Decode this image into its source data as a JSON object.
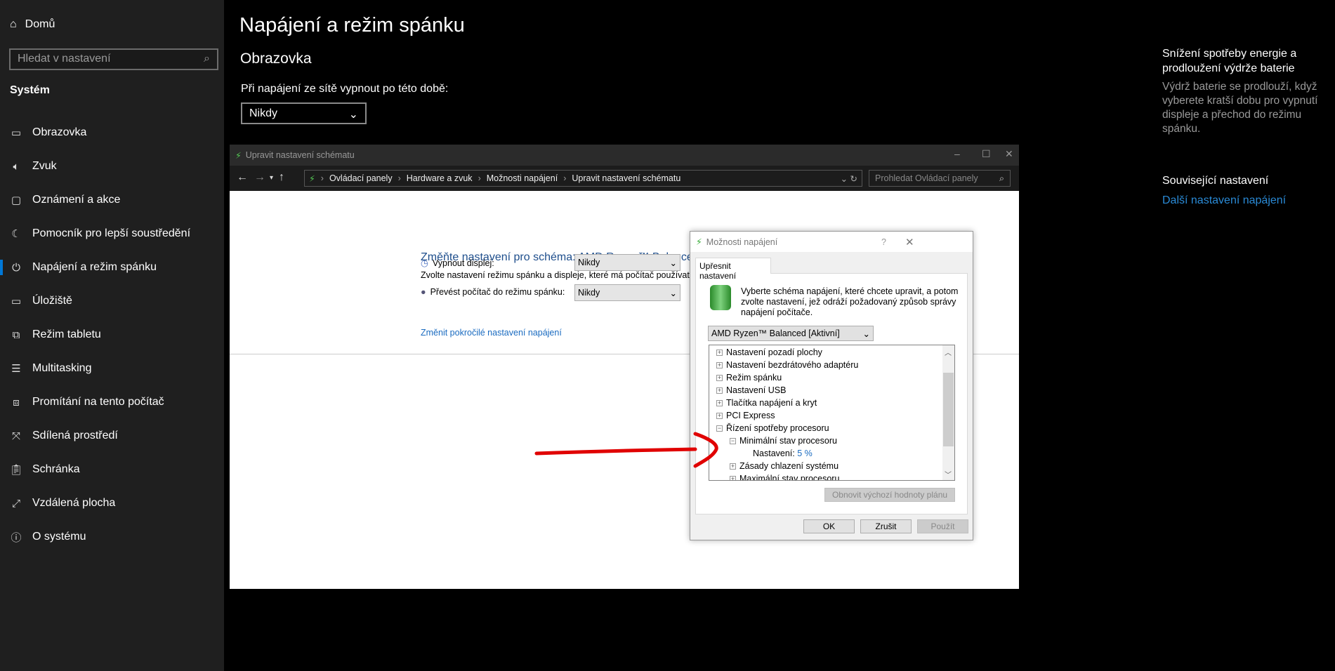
{
  "sidebar": {
    "home": "Domů",
    "search_placeholder": "Hledat v nastavení",
    "section": "Systém",
    "items": [
      {
        "label": "Obrazovka",
        "icon": "monitor-icon"
      },
      {
        "label": "Zvuk",
        "icon": "speaker-icon"
      },
      {
        "label": "Oznámení a akce",
        "icon": "notification-icon"
      },
      {
        "label": "Pomocník pro lepší soustředění",
        "icon": "moon-icon"
      },
      {
        "label": "Napájení a režim spánku",
        "icon": "power-icon"
      },
      {
        "label": "Úložiště",
        "icon": "storage-icon"
      },
      {
        "label": "Režim tabletu",
        "icon": "tablet-icon"
      },
      {
        "label": "Multitasking",
        "icon": "multitasking-icon"
      },
      {
        "label": "Promítání na tento počítač",
        "icon": "projecting-icon"
      },
      {
        "label": "Sdílená prostředí",
        "icon": "shared-icon"
      },
      {
        "label": "Schránka",
        "icon": "clipboard-icon"
      },
      {
        "label": "Vzdálená plocha",
        "icon": "remote-icon"
      },
      {
        "label": "O systému",
        "icon": "info-icon"
      }
    ]
  },
  "main": {
    "title": "Napájení a režim spánku",
    "section": "Obrazovka",
    "label": "Při napájení ze sítě vypnout po této době:",
    "dropdown": "Nikdy"
  },
  "right": {
    "heading": "Snížení spotřeby energie a prodloužení výdrže baterie",
    "text": "Výdrž baterie se prodlouží, když vyberete kratší dobu pro vypnutí displeje a přechod do režimu spánku.",
    "related": "Související nastavení",
    "link": "Další nastavení napájení"
  },
  "explorer": {
    "title": "Upravit nastavení schématu",
    "breadcrumb": [
      "Ovládací panely",
      "Hardware a zvuk",
      "Možnosti napájení",
      "Upravit nastavení schématu"
    ],
    "search_placeholder": "Prohledat Ovládací panely",
    "heading": "Změňte nastavení pro schéma: AMD Ryzen™ Balanced",
    "subtext": "Zvolte nastavení režimu spánku a displeje, které má počítač používat.",
    "display_label": "Vypnout displej:",
    "display_value": "Nikdy",
    "sleep_label": "Převést počítač do režimu spánku:",
    "sleep_value": "Nikdy",
    "advanced_link": "Změnit pokročilé nastavení napájení"
  },
  "dialog": {
    "title": "Možnosti napájení",
    "help": "?",
    "tab": "Upřesnit nastavení",
    "description": "Vyberte schéma napájení, které chcete upravit, a potom zvolte nastavení, jež odráží požadovaný způsob správy napájení počítače.",
    "scheme": "AMD Ryzen™ Balanced [Aktivní]",
    "tree": [
      {
        "label": "Nastavení pozadí plochy",
        "level": 0,
        "expanded": false
      },
      {
        "label": "Nastavení bezdrátového adaptéru",
        "level": 0,
        "expanded": false
      },
      {
        "label": "Režim spánku",
        "level": 0,
        "expanded": false
      },
      {
        "label": "Nastavení USB",
        "level": 0,
        "expanded": false
      },
      {
        "label": "Tlačítka napájení a kryt",
        "level": 0,
        "expanded": false
      },
      {
        "label": "PCI Express",
        "level": 0,
        "expanded": false
      },
      {
        "label": "Řízení spotřeby procesoru",
        "level": 0,
        "expanded": true
      },
      {
        "label": "Minimální stav procesoru",
        "level": 1,
        "expanded": true
      }
    ],
    "setting_label": "Nastavení:",
    "setting_value": "5 %",
    "tree_after": [
      {
        "label": "Zásady chlazení systému",
        "level": 1
      },
      {
        "label": "Maximální stav procesoru",
        "level": 1
      }
    ],
    "restore": "Obnovit výchozí hodnoty plánu",
    "ok": "OK",
    "cancel": "Zrušit",
    "apply": "Použít"
  },
  "colors": {
    "accent": "#0078d7",
    "link": "#1a6bc0",
    "annotation": "#e00000"
  }
}
